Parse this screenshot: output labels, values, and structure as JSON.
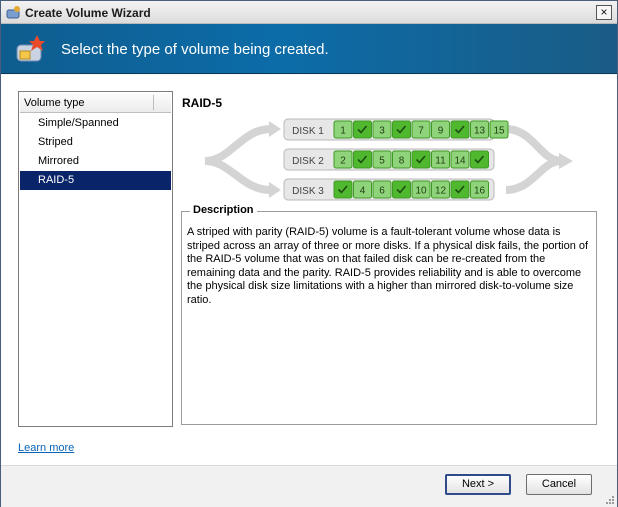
{
  "window": {
    "title": "Create Volume Wizard",
    "close_glyph": "×"
  },
  "header": {
    "text": "Select the type of volume being created.",
    "icon": "volume-wizard-icon"
  },
  "volume_list": {
    "column_header": "Volume type",
    "items": [
      "Simple/Spanned",
      "Striped",
      "Mirrored",
      "RAID-5"
    ],
    "selected": "RAID-5"
  },
  "main": {
    "title": "RAID-5",
    "disks": [
      {
        "label": "DISK 1",
        "cells": [
          "1",
          "check",
          "3",
          "check",
          "7",
          "9",
          "check",
          "13",
          "15"
        ]
      },
      {
        "label": "DISK 2",
        "cells": [
          "2",
          "check",
          "5",
          "8",
          "check",
          "11",
          "14",
          "check"
        ]
      },
      {
        "label": "DISK 3",
        "cells": [
          "check",
          "4",
          "6",
          "check",
          "10",
          "12",
          "check",
          "16"
        ]
      }
    ],
    "description_label": "Description",
    "description": "A striped with parity (RAID-5) volume is a fault-tolerant volume whose data is striped across an array of three or more disks. If a physical disk fails, the portion of the RAID-5 volume that was on that failed disk can be re-created from the remaining data and the parity. RAID-5 provides reliability and is able to overcome the physical disk size limitations with a higher than mirrored disk-to-volume size ratio."
  },
  "learn_more": "Learn more",
  "buttons": {
    "next": "Next >",
    "cancel": "Cancel"
  }
}
